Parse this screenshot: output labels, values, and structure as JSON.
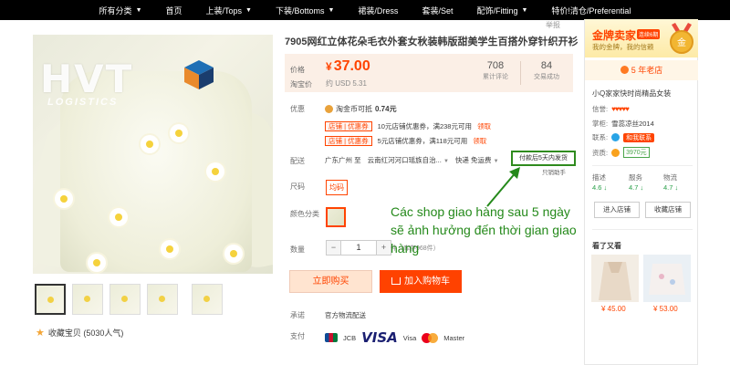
{
  "nav": {
    "items": [
      {
        "label": "所有分类",
        "caret": true
      },
      {
        "label": "首页",
        "caret": false
      },
      {
        "label": "上装/Tops",
        "caret": true
      },
      {
        "label": "下装/Bottoms",
        "caret": true
      },
      {
        "label": "裙装/Dress",
        "caret": false
      },
      {
        "label": "套装/Set",
        "caret": false
      },
      {
        "label": "配饰/Fitting",
        "caret": true
      },
      {
        "label": "特价!清仓/Preferential",
        "caret": false
      }
    ],
    "caret_glyph": "▼"
  },
  "report": "举报",
  "watermark": {
    "letters": "HVT",
    "sub": "LOGISTICS"
  },
  "product": {
    "title": "7905网红立体花朵毛衣外套女秋装韩版甜美学生百搭外穿针织开衫",
    "price_label": "价格",
    "price_symbol": "¥",
    "price": "37.00",
    "taobao_label": "淘宝价",
    "usd_price": "约 USD 5.31",
    "stats": [
      {
        "value": "708",
        "label": "累计评论"
      },
      {
        "value": "84",
        "label": "交易成功"
      }
    ],
    "promo_label": "优惠",
    "coin_text": "淘金币可抵",
    "coin_value": "0.74元",
    "coupons": [
      {
        "tag": "店铺 | 优惠券",
        "text": "10元店铺优惠券，满238元可用",
        "action": "领取"
      },
      {
        "tag": "店铺 | 优惠券",
        "text": "5元店铺优惠券，满118元可用",
        "action": "领取"
      }
    ],
    "ship_label": "配送",
    "ship_from": "广东广州 至",
    "ship_to": "云南红河河口瑶族自治...",
    "ship_method": "快递 免运费",
    "ship_time": "付款后5天内发货",
    "ship_note": "只销助手",
    "size_label": "尺码",
    "size_value": "均码",
    "color_label": "颜色分类",
    "qty_label": "数量",
    "qty_minus": "−",
    "qty_value": "1",
    "qty_plus": "+",
    "qty_note": "件（库存968件）",
    "buy_now": "立即购买",
    "add_cart": "加入购物车",
    "promise_label": "承诺",
    "promise_text": "官方物流配送",
    "pay_label": "支付",
    "pays": [
      "JCB",
      "VISA",
      "Visa",
      "Master"
    ],
    "favorite": "收藏宝贝 (5030人气)"
  },
  "annotation": {
    "text": "Các shop giao hàng sau 5 ngày sẽ ảnh hưởng đến thời gian giao hàng",
    "color": "#24891a"
  },
  "seller": {
    "gold_title": "金牌卖家",
    "gold_badge": "连续6期",
    "gold_sub": "我的金牌，我的信赖",
    "years": "5 年老店",
    "shop_name": "小Q家家快时尚精品女装",
    "credit_label": "信誉:",
    "credit_hearts": "♥♥♥♥♥",
    "keeper_label": "掌柜:",
    "keeper_name": "雪蕊凉丝2014",
    "contact_label": "联系:",
    "contact_btn": "和我联系",
    "qual_label": "资质:",
    "deposit": "3970元",
    "rates": [
      {
        "label": "描述",
        "value": "4.6 ↓"
      },
      {
        "label": "服务",
        "value": "4.7 ↓"
      },
      {
        "label": "物流",
        "value": "4.7 ↓"
      }
    ],
    "enter_shop": "进入店铺",
    "fav_shop": "收藏店铺",
    "seen_title": "看了又看",
    "recs": [
      {
        "price": "¥ 45.00"
      },
      {
        "price": "¥ 53.00"
      }
    ]
  }
}
